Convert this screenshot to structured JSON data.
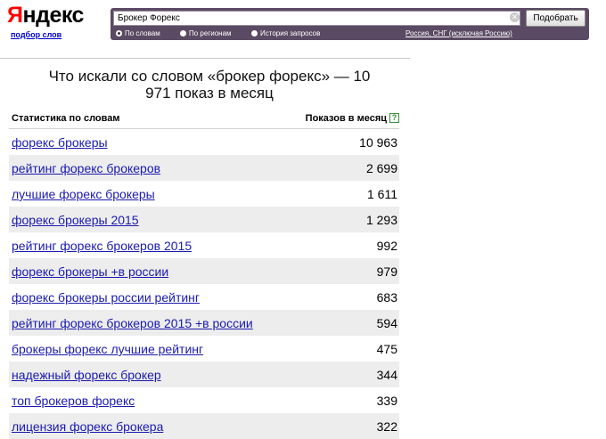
{
  "logo": {
    "first_letter": "Я",
    "rest": "ндекс",
    "sublink": "подбор слов"
  },
  "search": {
    "query": "Брокер Форекс",
    "clear_icon": "close-icon",
    "button_label": "Подобрать",
    "options": [
      {
        "label": "По словам",
        "selected": true
      },
      {
        "label": "По регионам",
        "selected": false
      },
      {
        "label": "История запросов",
        "selected": false
      }
    ],
    "region": "Россия, СНГ (исключая Россию)"
  },
  "heading": "Что искали со словом «брокер форекс» — 10 971 показ в месяц",
  "table": {
    "col_keyword": "Статистика по словам",
    "col_count": "Показов в месяц",
    "help": "?",
    "rows": [
      {
        "keyword": "форекс брокеры",
        "count": "10 963"
      },
      {
        "keyword": "рейтинг форекс брокеров",
        "count": "2 699"
      },
      {
        "keyword": "лучшие форекс брокеры",
        "count": "1 611"
      },
      {
        "keyword": "форекс брокеры 2015",
        "count": "1 293"
      },
      {
        "keyword": "рейтинг форекс брокеров 2015",
        "count": "992"
      },
      {
        "keyword": "форекс брокеры +в россии",
        "count": "979"
      },
      {
        "keyword": "форекс брокеры россии рейтинг",
        "count": "683"
      },
      {
        "keyword": "рейтинг форекс брокеров 2015 +в россии",
        "count": "594"
      },
      {
        "keyword": "брокеры форекс лучшие рейтинг",
        "count": "475"
      },
      {
        "keyword": "надежный форекс брокер",
        "count": "344"
      },
      {
        "keyword": "топ брокеров форекс",
        "count": "339"
      },
      {
        "keyword": "лицензия форекс брокера",
        "count": "322"
      }
    ]
  },
  "colors": {
    "searchbar": "#5b4a63",
    "link": "#1a1ab0",
    "logo_red": "#ff0000",
    "alt_row": "#ededed"
  }
}
